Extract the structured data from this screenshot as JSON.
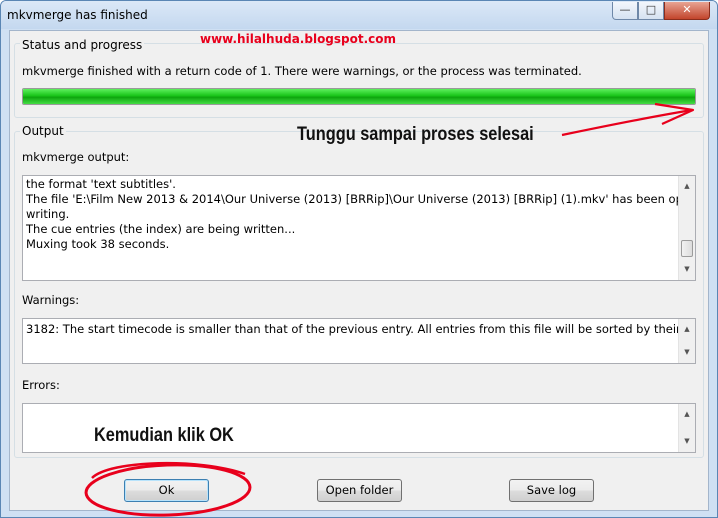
{
  "window": {
    "title": "mkvmerge has finished",
    "controls": {
      "minimize": "—",
      "maximize": "□",
      "close": "✕"
    }
  },
  "status": {
    "group_label": "Status and progress",
    "message": "mkvmerge finished with a return code of 1. There were warnings, or the process was terminated.",
    "progress_fraction": 1.0,
    "progress_color": "#19c419"
  },
  "output": {
    "group_label": "Output",
    "output_label": "mkvmerge output:",
    "lines": [
      "the format 'text subtitles'.",
      "The file 'E:\\Film New 2013 & 2014\\Our Universe (2013) [BRRip]\\Our Universe (2013) [BRRip] (1).mkv' has been opened for",
      "writing.",
      "The cue entries (the index) are being written...",
      "Muxing took 38 seconds."
    ],
    "warnings_label": "Warnings:",
    "warnings_text": "3182: The start timecode is smaller than that of the previous entry. All entries from this file will be sorted by their start time.",
    "errors_label": "Errors:",
    "errors_text": ""
  },
  "buttons": {
    "ok": "Ok",
    "open_folder": "Open folder",
    "save_log": "Save log"
  },
  "annotations": {
    "url": "www.hilalhuda.blogspot.com",
    "wait": "Tunggu sampai proses selesai",
    "then_click": "Kemudian klik OK",
    "mark_color": "#e8001c"
  }
}
